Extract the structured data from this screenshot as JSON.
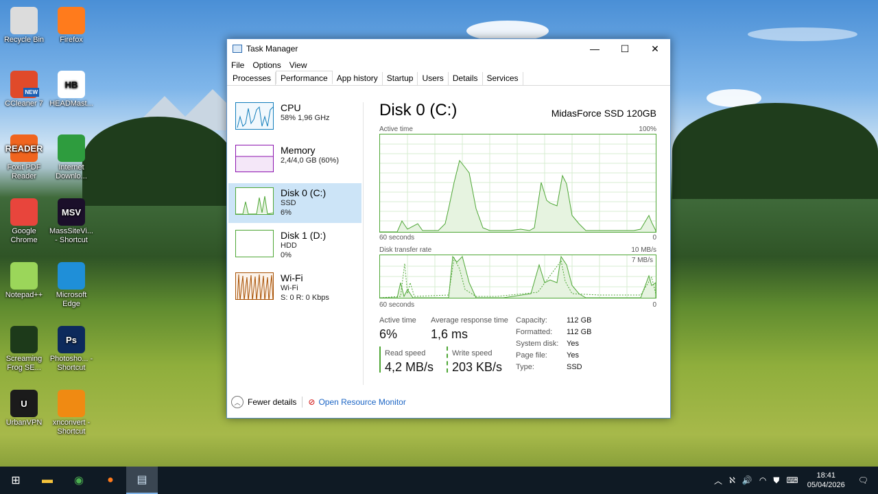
{
  "desktop": {
    "icons": [
      {
        "label": "Recycle Bin",
        "icon": "recycle-bin-icon",
        "color": "#dcdcdc"
      },
      {
        "label": "Firefox",
        "icon": "firefox-icon",
        "color": "#ff7b1c"
      },
      {
        "label": "CCleaner 7",
        "icon": "ccleaner-icon",
        "color": "#e04a2a",
        "badge": "NEW"
      },
      {
        "label": "HEADMast...",
        "icon": "headmaster-icon",
        "color": "#ffffff",
        "text": "HB"
      },
      {
        "label": "Foxit PDF Reader",
        "icon": "foxit-icon",
        "color": "#f0641e",
        "text": "READER"
      },
      {
        "label": "Internet Downlo...",
        "icon": "idm-icon",
        "color": "#2e9c3e"
      },
      {
        "label": "Google Chrome",
        "icon": "chrome-icon",
        "color": "#e8453c"
      },
      {
        "label": "MassSiteVi... - Shortcut",
        "icon": "msv-icon",
        "color": "#1b0f2a",
        "text": "MSV"
      },
      {
        "label": "Notepad++",
        "icon": "notepadpp-icon",
        "color": "#9bd65a"
      },
      {
        "label": "Microsoft Edge",
        "icon": "edge-icon",
        "color": "#1f8fd8"
      },
      {
        "label": "Screaming Frog SE...",
        "icon": "screaming-frog-icon",
        "color": "#1d3a1a"
      },
      {
        "label": "Photosho... - Shortcut",
        "icon": "photoshop-icon",
        "color": "#0d2a5c",
        "text": "Ps"
      },
      {
        "label": "UrbanVPN",
        "icon": "urbanvpn-icon",
        "color": "#1b1b1b",
        "text": "U"
      },
      {
        "label": "xnconvert - Shortcut",
        "icon": "xnconvert-icon",
        "color": "#f08a12"
      }
    ]
  },
  "window": {
    "title": "Task Manager",
    "menu": [
      "File",
      "Options",
      "View"
    ],
    "tabs": [
      "Processes",
      "Performance",
      "App history",
      "Startup",
      "Users",
      "Details",
      "Services"
    ],
    "active_tab": "Performance"
  },
  "sidebar": [
    {
      "name": "CPU",
      "sub1": "58% 1,96 GHz",
      "sub2": "",
      "color": "#117dbb"
    },
    {
      "name": "Memory",
      "sub1": "2,4/4,0 GB (60%)",
      "sub2": "",
      "color": "#8b12ae"
    },
    {
      "name": "Disk 0 (C:)",
      "sub1": "SSD",
      "sub2": "6%",
      "color": "#4da634"
    },
    {
      "name": "Disk 1 (D:)",
      "sub1": "HDD",
      "sub2": "0%",
      "color": "#4da634"
    },
    {
      "name": "Wi-Fi",
      "sub1": "Wi-Fi",
      "sub2": "S: 0 R: 0 Kbps",
      "color": "#a74f01"
    }
  ],
  "main": {
    "title": "Disk 0 (C:)",
    "model": "MidasForce SSD 120GB",
    "graph1": {
      "label": "Active time",
      "max": "100%",
      "xleft": "60 seconds",
      "xright": "0"
    },
    "graph2": {
      "label": "Disk transfer rate",
      "max": "10 MB/s",
      "inner": "7 MB/s",
      "xleft": "60 seconds",
      "xright": "0"
    },
    "stats": {
      "active_time_label": "Active time",
      "active_time": "6%",
      "avg_resp_label": "Average response time",
      "avg_resp": "1,6 ms",
      "read_label": "Read speed",
      "read": "4,2 MB/s",
      "write_label": "Write speed",
      "write": "203 KB/s"
    },
    "props": [
      {
        "k": "Capacity:",
        "v": "112 GB"
      },
      {
        "k": "Formatted:",
        "v": "112 GB"
      },
      {
        "k": "System disk:",
        "v": "Yes"
      },
      {
        "k": "Page file:",
        "v": "Yes"
      },
      {
        "k": "Type:",
        "v": "SSD"
      }
    ]
  },
  "footer": {
    "fewer": "Fewer details",
    "monitor": "Open Resource Monitor"
  },
  "taskbar": {
    "time": "18:41",
    "date": "05/04/2026",
    "apps": [
      "start-icon",
      "file-explorer-icon",
      "chrome-icon",
      "firefox-icon",
      "task-manager-icon"
    ]
  },
  "colors": {
    "disk": "#4da634",
    "accent": "#0078d7"
  }
}
